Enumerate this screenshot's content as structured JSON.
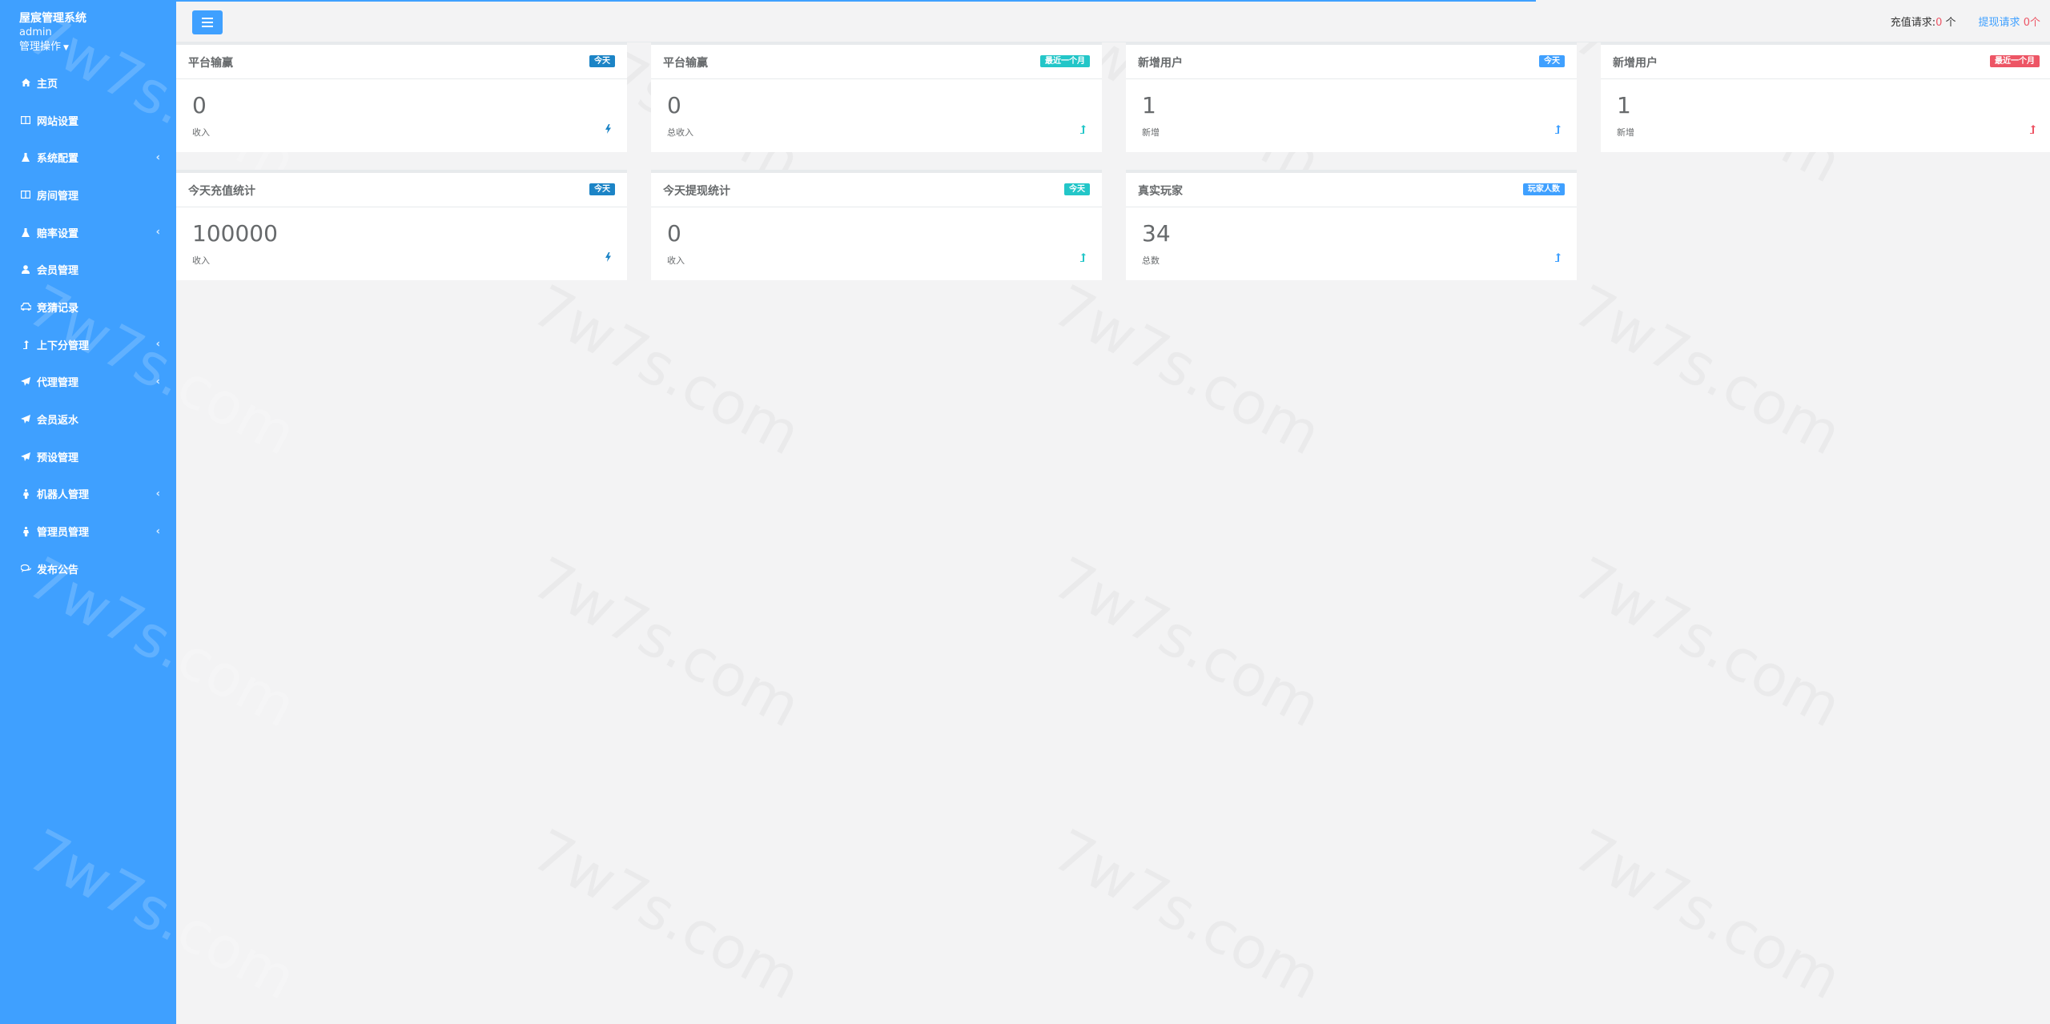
{
  "sidebar": {
    "app_title": "屋宸管理系统",
    "user": "admin",
    "ops": "管理操作",
    "items": [
      {
        "label": "主页",
        "icon": "home-icon",
        "arrow": false
      },
      {
        "label": "网站设置",
        "icon": "columns-icon",
        "arrow": false
      },
      {
        "label": "系统配置",
        "icon": "flask-icon",
        "arrow": true
      },
      {
        "label": "房间管理",
        "icon": "columns-icon",
        "arrow": false
      },
      {
        "label": "赔率设置",
        "icon": "flask-icon",
        "arrow": true
      },
      {
        "label": "会员管理",
        "icon": "user-icon",
        "arrow": false
      },
      {
        "label": "竞猜记录",
        "icon": "car-icon",
        "arrow": false
      },
      {
        "label": "上下分管理",
        "icon": "level-up-icon",
        "arrow": true
      },
      {
        "label": "代理管理",
        "icon": "paper-plane-icon",
        "arrow": true
      },
      {
        "label": "会员返水",
        "icon": "paper-plane-icon",
        "arrow": false
      },
      {
        "label": "预设管理",
        "icon": "paper-plane-icon",
        "arrow": false
      },
      {
        "label": "机器人管理",
        "icon": "person-icon",
        "arrow": true
      },
      {
        "label": "管理员管理",
        "icon": "person-icon",
        "arrow": true
      },
      {
        "label": "发布公告",
        "icon": "comments-icon",
        "arrow": false
      }
    ]
  },
  "topbar": {
    "recharge_label": "充值请求:",
    "recharge_count": "0",
    "recharge_unit": " 个",
    "withdraw_label": "提现请求",
    "withdraw_count": "0",
    "withdraw_unit": "个"
  },
  "cards": [
    {
      "title": "平台输赢",
      "badge": "今天",
      "badge_color": "#1c84c6",
      "value": "0",
      "sub": "收入",
      "icon": "bolt-icon",
      "icon_color": "#1c84c6"
    },
    {
      "title": "平台输赢",
      "badge": "最近一个月",
      "badge_color": "#23c6c8",
      "value": "0",
      "sub": "总收入",
      "icon": "level-up-icon",
      "icon_color": "#23c6c8"
    },
    {
      "title": "新增用户",
      "badge": "今天",
      "badge_color": "#3fa0ff",
      "value": "1",
      "sub": "新增",
      "icon": "level-up-icon",
      "icon_color": "#3fa0ff"
    },
    {
      "title": "新增用户",
      "badge": "最近一个月",
      "badge_color": "#ed5565",
      "value": "1",
      "sub": "新增",
      "icon": "level-up-icon",
      "icon_color": "#ed5565"
    },
    {
      "title": "今天充值统计",
      "badge": "今天",
      "badge_color": "#1c84c6",
      "value": "100000",
      "sub": "收入",
      "icon": "bolt-icon",
      "icon_color": "#1c84c6"
    },
    {
      "title": "今天提现统计",
      "badge": "今天",
      "badge_color": "#23c6c8",
      "value": "0",
      "sub": "收入",
      "icon": "level-up-icon",
      "icon_color": "#23c6c8"
    },
    {
      "title": "真实玩家",
      "badge": "玩家人数",
      "badge_color": "#3fa0ff",
      "value": "34",
      "sub": "总数",
      "icon": "level-up-icon",
      "icon_color": "#3fa0ff"
    }
  ]
}
